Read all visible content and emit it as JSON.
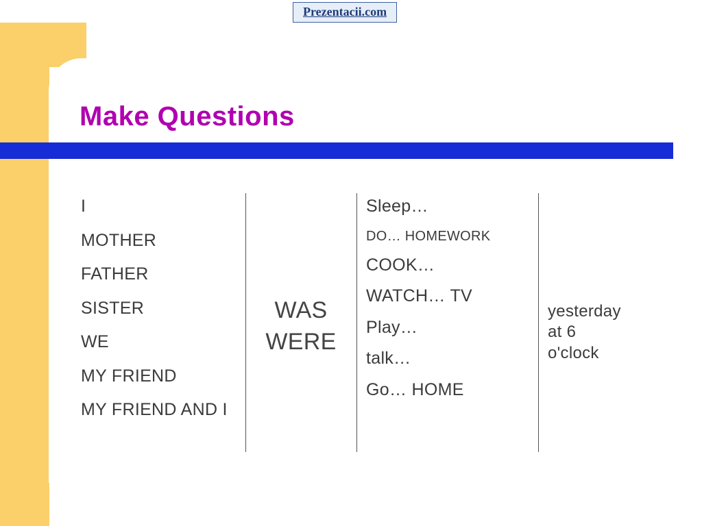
{
  "link": {
    "text": "Prezentacii.com"
  },
  "slide": {
    "title": "Make Questions",
    "columns": {
      "subjects": [
        "I",
        "MOTHER",
        "FATHER",
        "SISTER",
        "WE",
        "MY FRIEND",
        "MY FRIEND AND I"
      ],
      "aux": [
        "WAS",
        "WERE"
      ],
      "actions": [
        "Sleep…",
        "DO… HOMEWORK",
        "COOK…",
        "WATCH… TV",
        "Play…",
        "talk…",
        "Go… HOME"
      ],
      "time": [
        "yesterday",
        "at 6",
        "o'clock"
      ]
    }
  }
}
